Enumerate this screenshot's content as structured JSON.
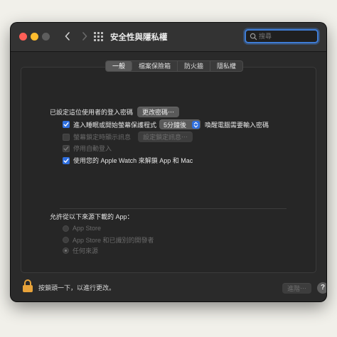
{
  "window": {
    "title": "安全性與隱私權",
    "search_placeholder": "搜尋"
  },
  "tabs": [
    {
      "label": "一般",
      "active": true
    },
    {
      "label": "檔案保險箱",
      "active": false
    },
    {
      "label": "防火牆",
      "active": false
    },
    {
      "label": "隱私權",
      "active": false
    }
  ],
  "general": {
    "password_label": "已設定這位使用者的登入密碼",
    "change_password_button": "更改密碼⋯",
    "sleep_checkbox_label": "進入睡眠或開始螢幕保護程式",
    "sleep_checked": true,
    "require_password_select": "5分鐘後",
    "require_password_suffix": "喚醒電腦需要輸入密碼",
    "show_message_label": "螢幕鎖定時顯示訊息",
    "show_message_checked": false,
    "set_lock_message_button": "設定鎖定訊息⋯",
    "disable_auto_login_label": "停用自動登入",
    "disable_auto_login_checked": true,
    "apple_watch_label": "使用您的 Apple Watch 來解鎖 App 和 Mac",
    "apple_watch_checked": true
  },
  "downloads": {
    "heading": "允許從以下來源下載的 App：",
    "options": [
      {
        "label": "App Store",
        "selected": false
      },
      {
        "label": "App Store 和已識別的開發者",
        "selected": false
      },
      {
        "label": "任何來源",
        "selected": true
      }
    ]
  },
  "footer": {
    "lock_text": "按鎖頭一下，以進行更改。",
    "advanced_button": "進階⋯",
    "help_button": "?"
  },
  "colors": {
    "accent": "#2f6fde",
    "search_focus": "#3f7dd6",
    "lock": "#e8a33a"
  }
}
